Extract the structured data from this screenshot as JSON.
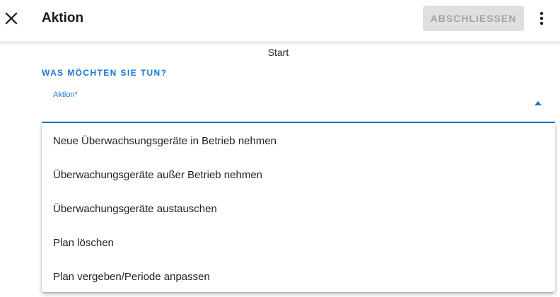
{
  "header": {
    "title": "Aktion",
    "finish_label": "ABSCHLIESSEN",
    "close_icon": "close-icon",
    "more_icon": "more-vert-icon"
  },
  "main": {
    "step_label": "Start",
    "section_heading": "WAS MÖCHTEN SIE TUN?",
    "select": {
      "label": "Aktion*",
      "value": "",
      "open": true
    },
    "menu_items": [
      {
        "label": "Neue Überwachsungsgeräte in Betrieb nehmen"
      },
      {
        "label": "Überwachungsgeräte außer Betrieb nehmen"
      },
      {
        "label": "Überwachungsgeräte austauschen"
      },
      {
        "label": "Plan löschen"
      },
      {
        "label": "Plan vergeben/Periode anpassen"
      }
    ]
  },
  "colors": {
    "accent": "#1976d2",
    "disabled_button_bg": "#e0e0e0",
    "disabled_button_text": "#a3a3a3",
    "divider": "#eeeeee"
  }
}
